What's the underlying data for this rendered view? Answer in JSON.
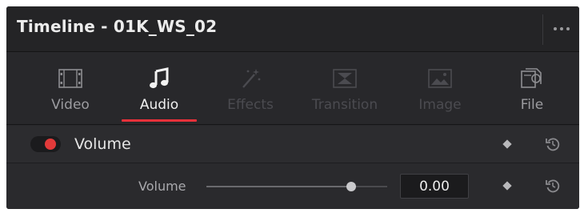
{
  "header": {
    "title": "Timeline - 01K_WS_02",
    "more_icon": "ellipsis-icon"
  },
  "tabs": [
    {
      "label": "Video",
      "icon": "film-strip-icon",
      "state": "normal"
    },
    {
      "label": "Audio",
      "icon": "music-note-icon",
      "state": "active"
    },
    {
      "label": "Effects",
      "icon": "magic-wand-icon",
      "state": "disabled"
    },
    {
      "label": "Transition",
      "icon": "transition-icon",
      "state": "disabled"
    },
    {
      "label": "Image",
      "icon": "image-icon",
      "state": "disabled"
    },
    {
      "label": "File",
      "icon": "file-icon",
      "state": "normal"
    }
  ],
  "volume_section": {
    "title": "Volume",
    "enabled": true,
    "param": {
      "label": "Volume",
      "value": "0.00",
      "slider_fraction": 0.8
    }
  },
  "colors": {
    "accent": "#e8313a",
    "toggle_on": "#e23a3a",
    "panel_bg": "#28282b"
  }
}
